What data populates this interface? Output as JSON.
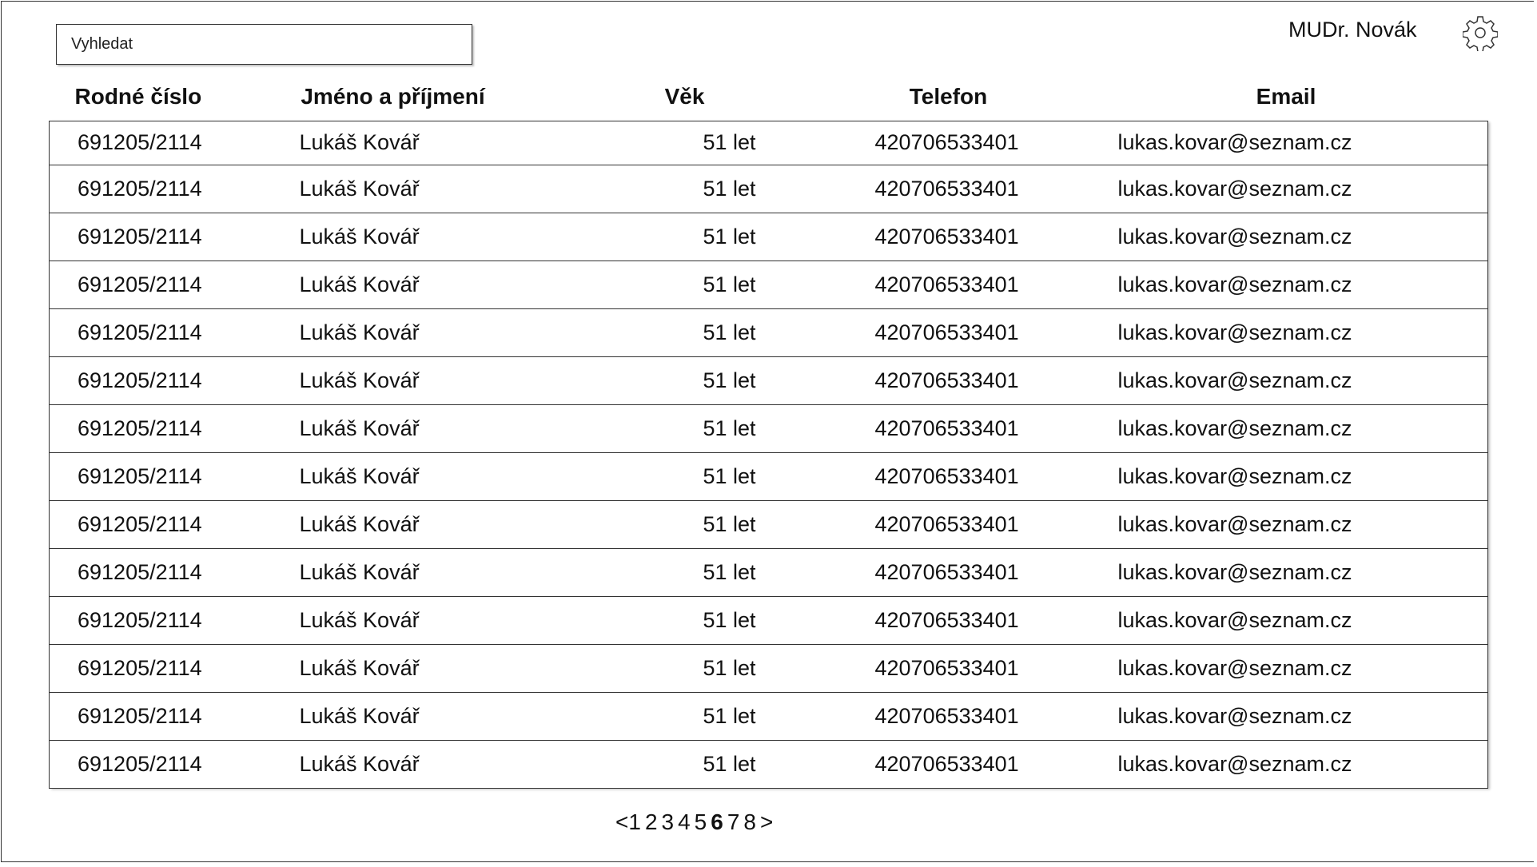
{
  "search": {
    "placeholder": "Vyhledat"
  },
  "user": {
    "name": "MUDr. Novák"
  },
  "icons": {
    "settings": "gear-icon"
  },
  "table": {
    "headers": [
      "Rodné číslo",
      "Jméno a příjmení",
      "Věk",
      "Telefon",
      "Email"
    ],
    "rows": [
      [
        "691205/2114",
        "Lukáš Kovář",
        "51 let",
        "420706533401",
        "lukas.kovar@seznam.cz"
      ],
      [
        "691205/2114",
        "Lukáš Kovář",
        "51 let",
        "420706533401",
        "lukas.kovar@seznam.cz"
      ],
      [
        "691205/2114",
        "Lukáš Kovář",
        "51 let",
        "420706533401",
        "lukas.kovar@seznam.cz"
      ],
      [
        "691205/2114",
        "Lukáš Kovář",
        "51 let",
        "420706533401",
        "lukas.kovar@seznam.cz"
      ],
      [
        "691205/2114",
        "Lukáš Kovář",
        "51 let",
        "420706533401",
        "lukas.kovar@seznam.cz"
      ],
      [
        "691205/2114",
        "Lukáš Kovář",
        "51 let",
        "420706533401",
        "lukas.kovar@seznam.cz"
      ],
      [
        "691205/2114",
        "Lukáš Kovář",
        "51 let",
        "420706533401",
        "lukas.kovar@seznam.cz"
      ],
      [
        "691205/2114",
        "Lukáš Kovář",
        "51 let",
        "420706533401",
        "lukas.kovar@seznam.cz"
      ],
      [
        "691205/2114",
        "Lukáš Kovář",
        "51 let",
        "420706533401",
        "lukas.kovar@seznam.cz"
      ],
      [
        "691205/2114",
        "Lukáš Kovář",
        "51 let",
        "420706533401",
        "lukas.kovar@seznam.cz"
      ],
      [
        "691205/2114",
        "Lukáš Kovář",
        "51 let",
        "420706533401",
        "lukas.kovar@seznam.cz"
      ],
      [
        "691205/2114",
        "Lukáš Kovář",
        "51 let",
        "420706533401",
        "lukas.kovar@seznam.cz"
      ],
      [
        "691205/2114",
        "Lukáš Kovář",
        "51 let",
        "420706533401",
        "lukas.kovar@seznam.cz"
      ],
      [
        "691205/2114",
        "Lukáš Kovář",
        "51 let",
        "420706533401",
        "lukas.kovar@seznam.cz"
      ]
    ]
  },
  "pagination": {
    "prev": "<",
    "pages": [
      "1",
      "2",
      "3",
      "4",
      "5",
      "6",
      "7",
      "8"
    ],
    "current": "6",
    "next": ">"
  }
}
